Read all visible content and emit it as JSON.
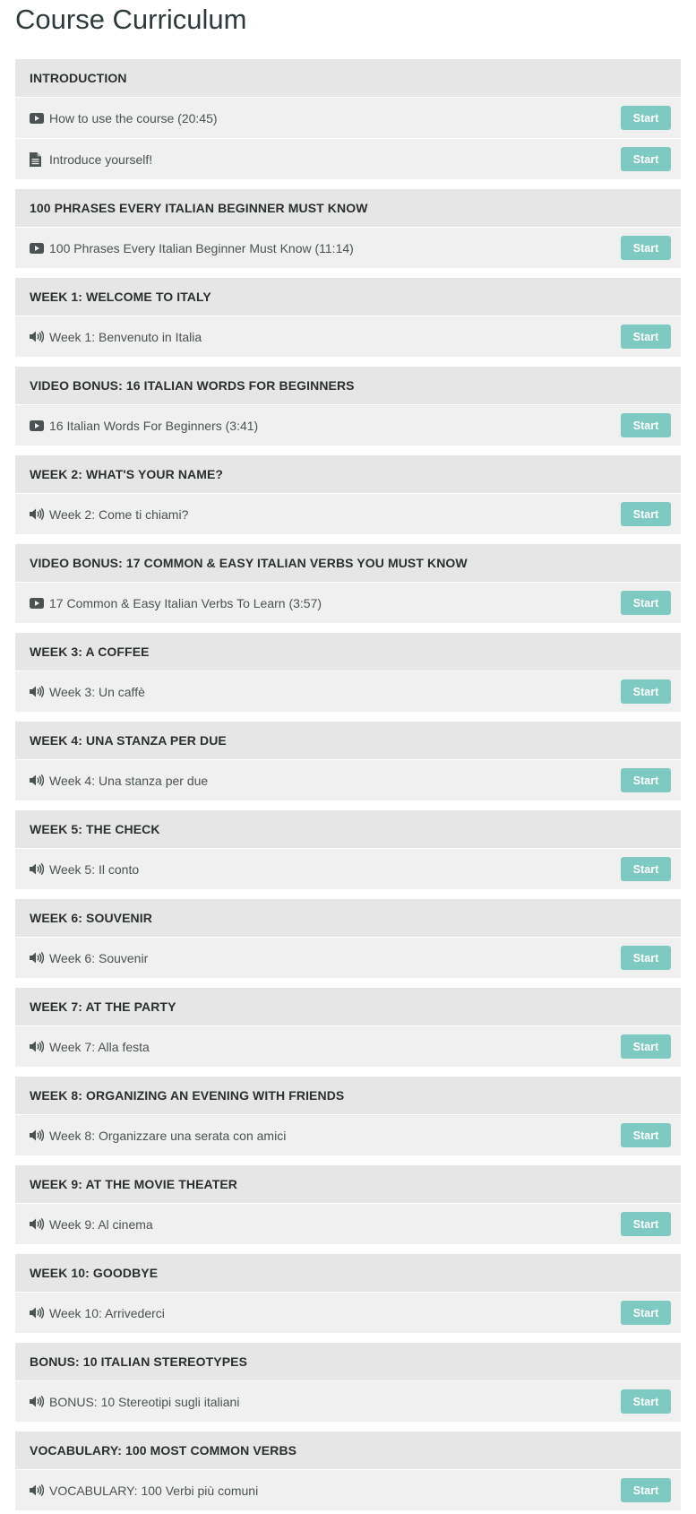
{
  "page_title": "Course Curriculum",
  "start_label": "Start",
  "colors": {
    "button": "#7ecac2",
    "header_bg": "#e6e6e6",
    "row_bg": "#f0f0f0"
  },
  "sections": [
    {
      "title": "INTRODUCTION",
      "items": [
        {
          "icon": "video-icon",
          "title": "How to use the course (20:45)"
        },
        {
          "icon": "document-icon",
          "title": "Introduce yourself!"
        }
      ]
    },
    {
      "title": "100 PHRASES EVERY ITALIAN BEGINNER MUST KNOW",
      "items": [
        {
          "icon": "video-icon",
          "title": "100 Phrases Every Italian Beginner Must Know (11:14)"
        }
      ]
    },
    {
      "title": "WEEK 1: WELCOME TO ITALY",
      "items": [
        {
          "icon": "audio-icon",
          "title": "Week 1: Benvenuto in Italia"
        }
      ]
    },
    {
      "title": "VIDEO BONUS: 16 ITALIAN WORDS FOR BEGINNERS",
      "items": [
        {
          "icon": "video-icon",
          "title": "16 Italian Words For Beginners (3:41)"
        }
      ]
    },
    {
      "title": "WEEK 2: WHAT'S YOUR NAME?",
      "items": [
        {
          "icon": "audio-icon",
          "title": "Week 2: Come ti chiami?"
        }
      ]
    },
    {
      "title": "VIDEO BONUS: 17 COMMON & EASY ITALIAN VERBS YOU MUST KNOW",
      "items": [
        {
          "icon": "video-icon",
          "title": "17 Common & Easy Italian Verbs To Learn (3:57)"
        }
      ]
    },
    {
      "title": "WEEK 3: A COFFEE",
      "items": [
        {
          "icon": "audio-icon",
          "title": "Week 3: Un caffè"
        }
      ]
    },
    {
      "title": "WEEK 4: UNA STANZA PER DUE",
      "items": [
        {
          "icon": "audio-icon",
          "title": "Week 4: Una stanza per due"
        }
      ]
    },
    {
      "title": "WEEK 5: THE CHECK",
      "items": [
        {
          "icon": "audio-icon",
          "title": "Week 5: Il conto"
        }
      ]
    },
    {
      "title": "WEEK 6: SOUVENIR",
      "items": [
        {
          "icon": "audio-icon",
          "title": "Week 6: Souvenir"
        }
      ]
    },
    {
      "title": "WEEK 7: AT THE PARTY",
      "items": [
        {
          "icon": "audio-icon",
          "title": "Week 7: Alla festa"
        }
      ]
    },
    {
      "title": "WEEK 8: ORGANIZING AN EVENING WITH FRIENDS",
      "items": [
        {
          "icon": "audio-icon",
          "title": "Week 8: Organizzare una serata con amici"
        }
      ]
    },
    {
      "title": "WEEK 9: AT THE MOVIE THEATER",
      "items": [
        {
          "icon": "audio-icon",
          "title": "Week 9: Al cinema"
        }
      ]
    },
    {
      "title": "WEEK 10: GOODBYE",
      "items": [
        {
          "icon": "audio-icon",
          "title": "Week 10: Arrivederci"
        }
      ]
    },
    {
      "title": "BONUS: 10 ITALIAN STEREOTYPES",
      "items": [
        {
          "icon": "audio-icon",
          "title": "BONUS: 10 Stereotipi sugli italiani"
        }
      ]
    },
    {
      "title": "VOCABULARY: 100 MOST COMMON VERBS",
      "items": [
        {
          "icon": "audio-icon",
          "title": "VOCABULARY: 100 Verbi più comuni"
        }
      ]
    }
  ]
}
